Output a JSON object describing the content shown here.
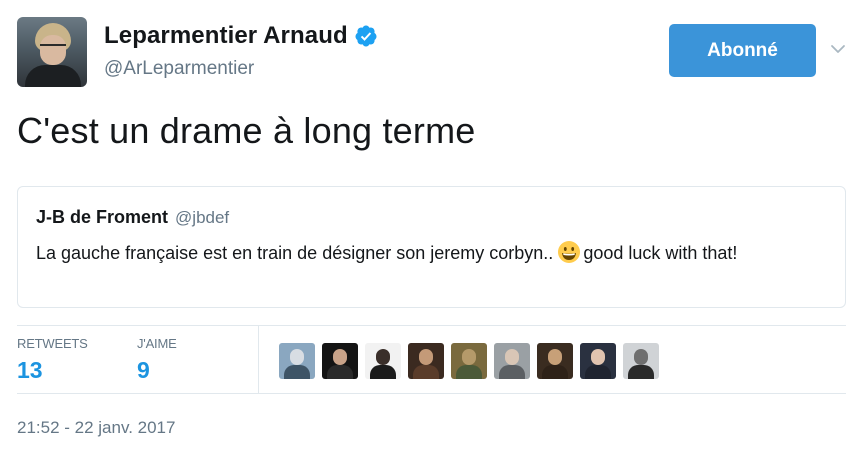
{
  "author": {
    "display_name": "Leparmentier Arnaud",
    "handle": "@ArLeparmentier",
    "verified": true
  },
  "follow_button": {
    "label": "Abonné"
  },
  "tweet": {
    "text": "C'est un drame à long terme",
    "timestamp": "21:52 - 22 janv. 2017"
  },
  "quoted_tweet": {
    "author_name": "J-B de Froment",
    "author_handle": "@jbdef",
    "text_before_emoji": "La gauche française est en train de désigner son jeremy corbyn..",
    "emoji": "grinning-face",
    "text_after_emoji": "good luck with that!"
  },
  "stats": {
    "retweets_label": "RETWEETS",
    "retweets_count": "13",
    "likes_label": "J'AIME",
    "likes_count": "9"
  },
  "likers": [
    {
      "bg": "#8aa7c0",
      "head": "#d8dde3",
      "body": "#3e5466"
    },
    {
      "bg": "#141414",
      "head": "#c9a389",
      "body": "#2a2a2a"
    },
    {
      "bg": "#f2f2f2",
      "head": "#3a2f2a",
      "body": "#1b1b1b"
    },
    {
      "bg": "#3b2a20",
      "head": "#c49a78",
      "body": "#5a3c2a"
    },
    {
      "bg": "#7a6a3e",
      "head": "#b59a6a",
      "body": "#4b5a38"
    },
    {
      "bg": "#9aa0a4",
      "head": "#d9c6b6",
      "body": "#5b5f63"
    },
    {
      "bg": "#3a2c20",
      "head": "#c7a078",
      "body": "#2e2218"
    },
    {
      "bg": "#2a3140",
      "head": "#e1c4b0",
      "body": "#1f2430"
    },
    {
      "bg": "#d0d3d6",
      "head": "#6f6f6f",
      "body": "#2a2a2a"
    }
  ],
  "colors": {
    "accent": "#3b94d9",
    "link": "#1c94e0",
    "secondary_text": "#657786",
    "border": "#e1e8ed"
  }
}
